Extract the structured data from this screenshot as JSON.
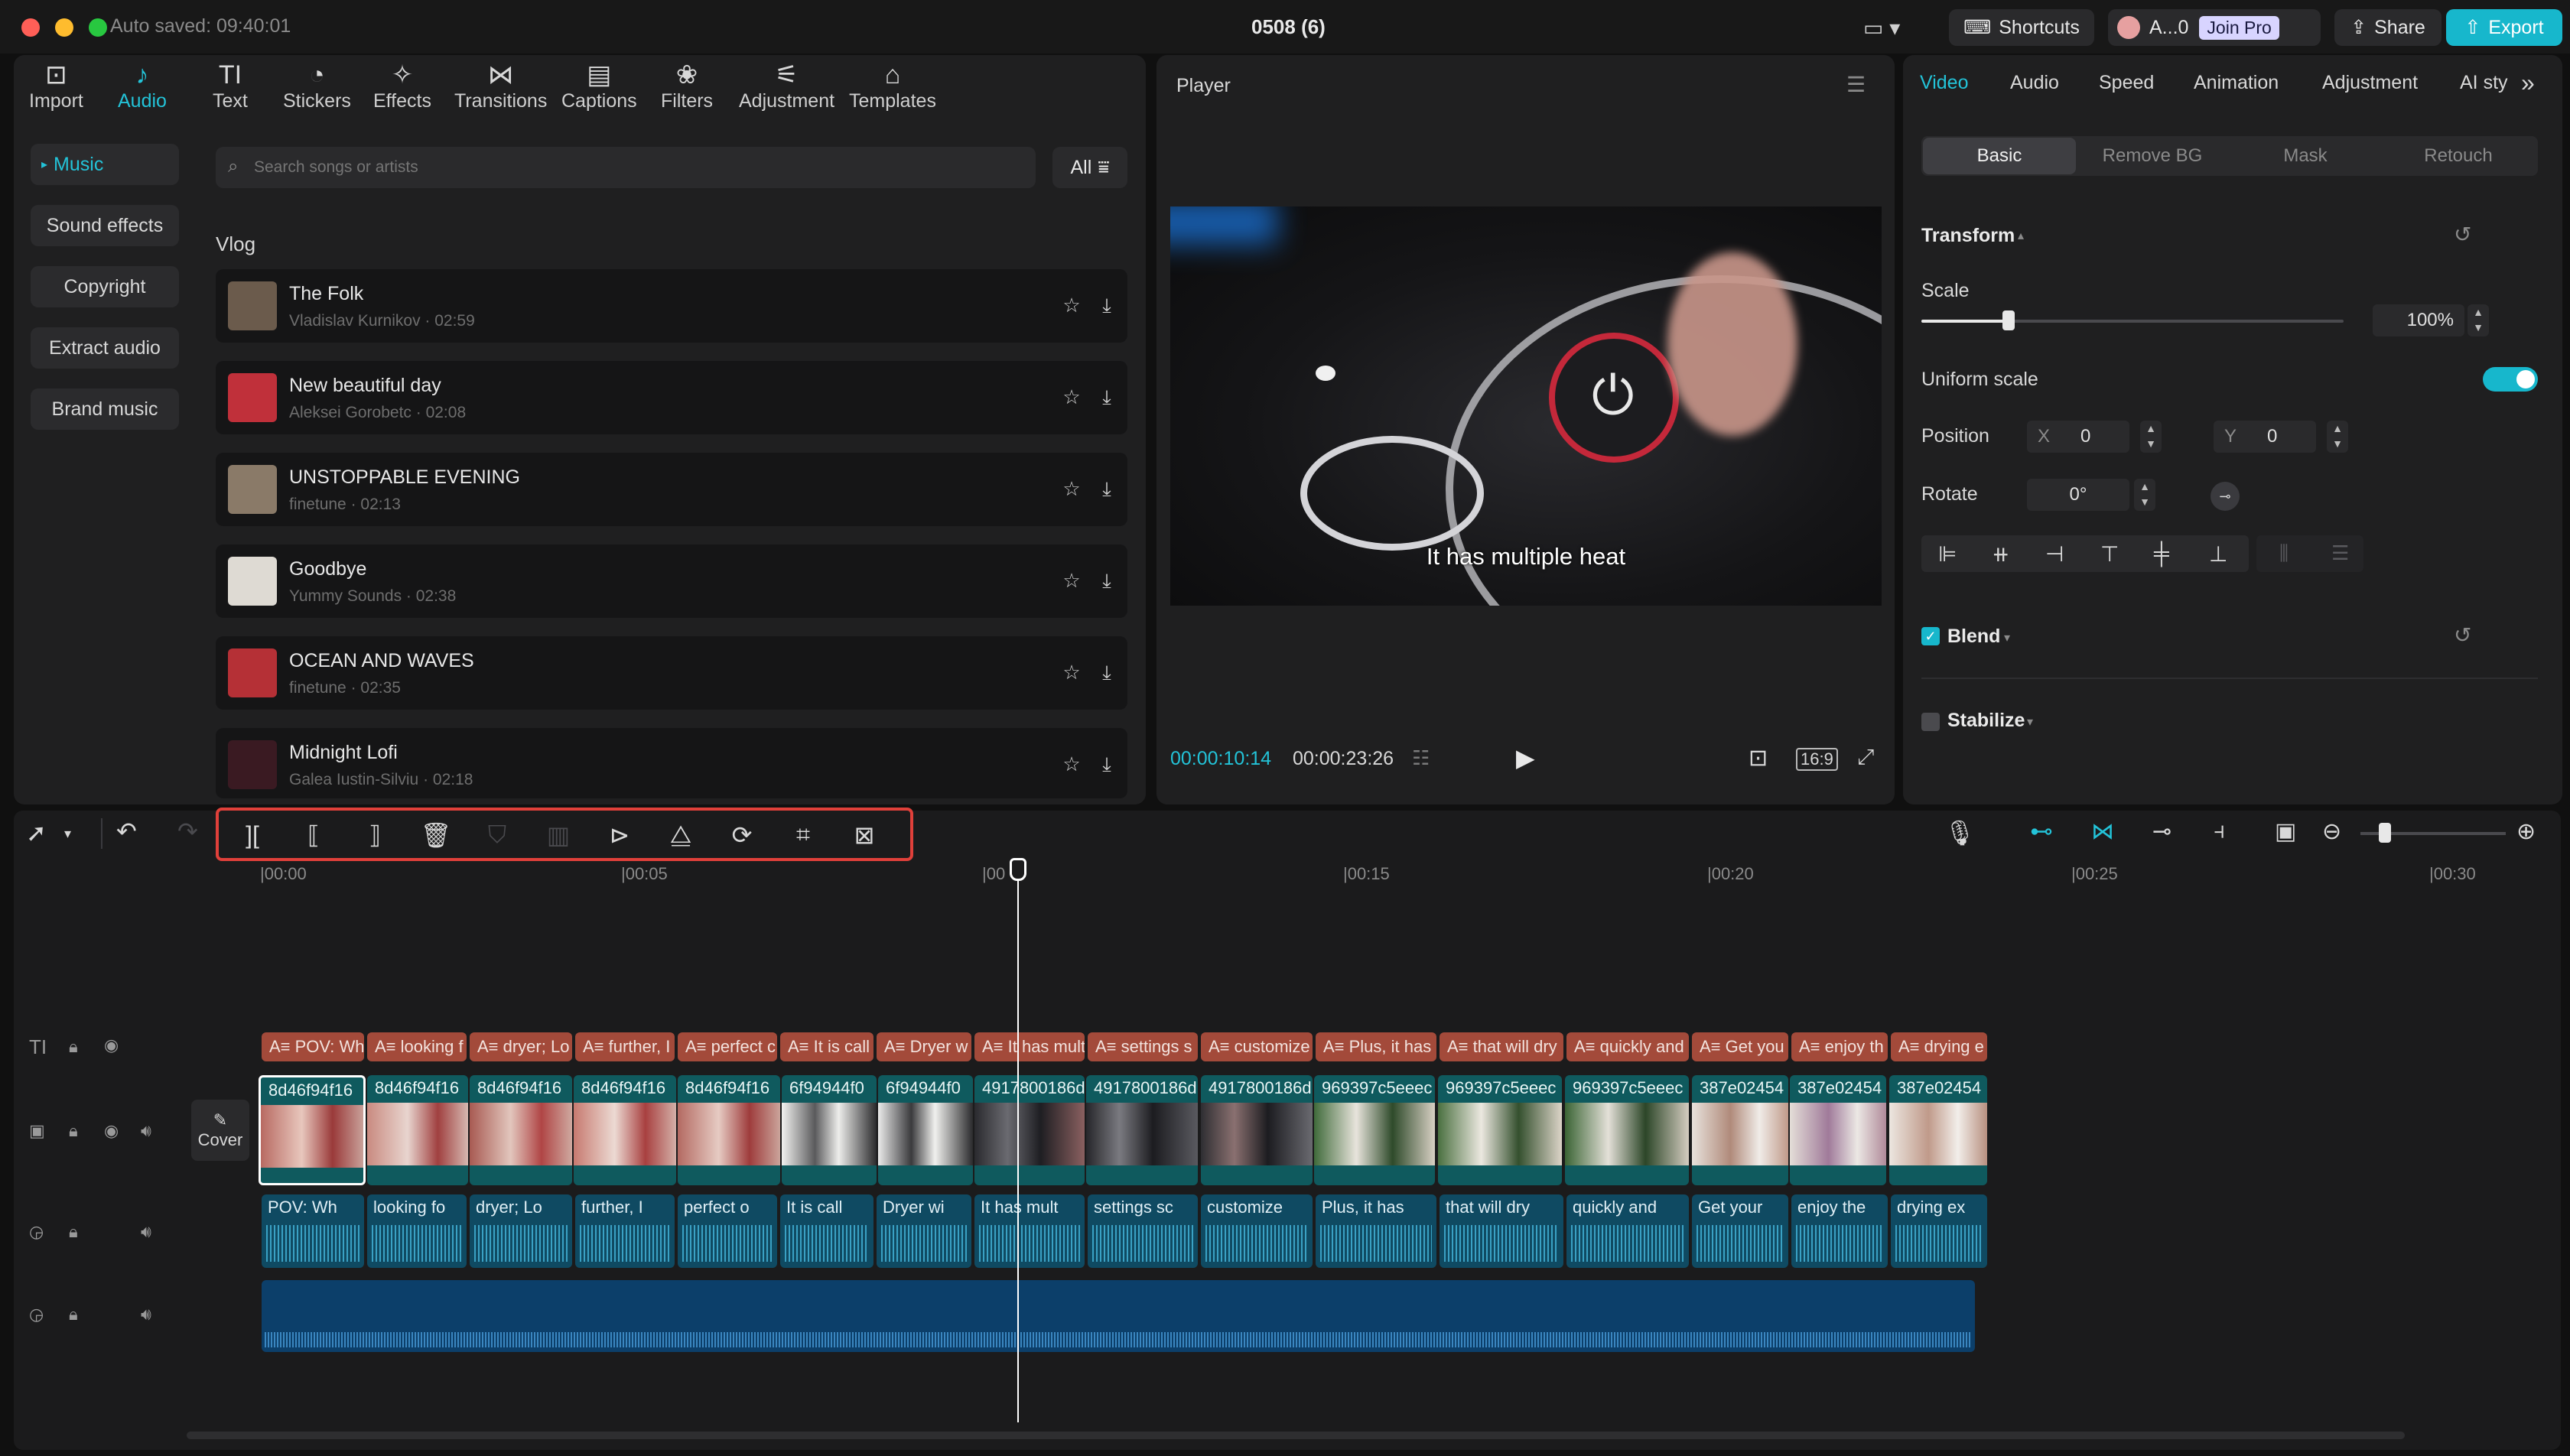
{
  "titlebar": {
    "autosave": "Auto saved: 09:40:01",
    "project": "0508 (6)",
    "shortcuts": "Shortcuts",
    "account": "A...0",
    "join_pro": "Join Pro",
    "share": "Share",
    "export": "Export"
  },
  "toolbar": {
    "items": [
      {
        "label": "Import",
        "icon": "import-icon"
      },
      {
        "label": "Audio",
        "icon": "audio-icon"
      },
      {
        "label": "Text",
        "icon": "text-icon"
      },
      {
        "label": "Stickers",
        "icon": "stickers-icon"
      },
      {
        "label": "Effects",
        "icon": "effects-icon"
      },
      {
        "label": "Transitions",
        "icon": "transitions-icon"
      },
      {
        "label": "Captions",
        "icon": "captions-icon"
      },
      {
        "label": "Filters",
        "icon": "filters-icon"
      },
      {
        "label": "Adjustment",
        "icon": "adjustment-icon"
      },
      {
        "label": "Templates",
        "icon": "templates-icon"
      }
    ]
  },
  "sidebar": {
    "items": [
      {
        "label": "Music"
      },
      {
        "label": "Sound effects"
      },
      {
        "label": "Copyright"
      },
      {
        "label": "Extract audio"
      },
      {
        "label": "Brand music"
      }
    ]
  },
  "search": {
    "placeholder": "Search songs or artists",
    "filter": "All"
  },
  "music": {
    "category": "Vlog",
    "songs": [
      {
        "title": "The Folk",
        "meta": "Vladislav Kurnikov · 02:59",
        "color": "#6b5b4c"
      },
      {
        "title": "New beautiful day",
        "meta": "Aleksei Gorobetc · 02:08",
        "color": "#c0303a"
      },
      {
        "title": "UNSTOPPABLE EVENING",
        "meta": "finetune · 02:13",
        "color": "#8a7a68"
      },
      {
        "title": "Goodbye",
        "meta": "Yummy Sounds · 02:38",
        "color": "#dedad3"
      },
      {
        "title": "OCEAN AND WAVES",
        "meta": "finetune · 02:35",
        "color": "#b53036"
      },
      {
        "title": "Midnight Lofi",
        "meta": "Galea Iustin-Silviu · 02:18",
        "color": "#3a1a22"
      }
    ]
  },
  "player": {
    "title": "Player",
    "subtitle": "It has multiple heat",
    "current_time": "00:00:10:14",
    "total_time": "00:00:23:26",
    "ratio": "16:9"
  },
  "props": {
    "tabs": [
      "Video",
      "Audio",
      "Speed",
      "Animation",
      "Adjustment",
      "AI sty"
    ],
    "subtabs": [
      "Basic",
      "Remove BG",
      "Mask",
      "Retouch"
    ],
    "transform": "Transform",
    "scale_label": "Scale",
    "scale_value": "100%",
    "uniform_scale": "Uniform scale",
    "position_label": "Position",
    "pos_x_label": "X",
    "pos_x": "0",
    "pos_y_label": "Y",
    "pos_y": "0",
    "rotate_label": "Rotate",
    "rotate_value": "0°",
    "blend": "Blend",
    "stabilize": "Stabilize"
  },
  "timeline": {
    "ticks": [
      "|00:00",
      "|00:05",
      "|00",
      "|00:15",
      "|00:20",
      "|00:25",
      "|00:30"
    ],
    "cover": "Cover",
    "text_clips": [
      "POV: Wh",
      "looking f",
      "dryer; Lo",
      "further, I",
      "perfect c",
      "It is call",
      "Dryer w",
      "It has mult",
      "settings s",
      "customize",
      "Plus, it has",
      "that will dry",
      "quickly and",
      "Get you",
      "enjoy th",
      "drying e"
    ],
    "video_clips": [
      "8d46f94f16",
      "8d46f94f16",
      "8d46f94f16",
      "8d46f94f16",
      "8d46f94f16",
      "6f94944f0",
      "6f94944f0",
      "4917800186d",
      "4917800186d",
      "4917800186d",
      "969397c5eeec",
      "969397c5eeec",
      "969397c5eeec",
      "387e02454",
      "387e02454",
      "387e02454"
    ],
    "audio_clips": [
      "POV: Wh",
      "looking fo",
      "dryer; Lo",
      "further, I",
      "perfect o",
      "It is call",
      "Dryer wi",
      "It has mult",
      "settings sc",
      "customize",
      "Plus, it has",
      "that will dry",
      "quickly and",
      "Get your",
      "enjoy the",
      "drying ex"
    ]
  }
}
